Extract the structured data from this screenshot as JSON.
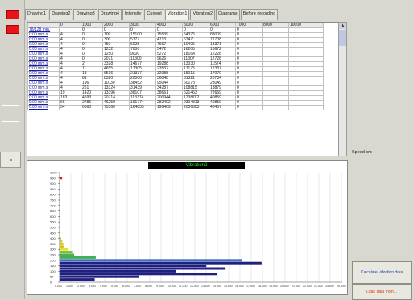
{
  "tabs": [
    "Drawing1",
    "Drawing2",
    "Drawing3",
    "Drawing4",
    "Intensity",
    "Current",
    "Vibration1",
    "Vibration2",
    "Diagrams",
    "Before recording"
  ],
  "table": {
    "headers": [
      "",
      "0",
      "1000",
      "2000",
      "3000",
      "4000",
      "5000",
      "6000",
      "7000",
      "8000",
      "10000"
    ],
    "rows": [
      [
        "78/128 min.",
        "",
        "0",
        "0",
        "0",
        "0",
        "0",
        "0",
        "0",
        "",
        ""
      ],
      [
        "0:00 mm.s",
        "4",
        "0",
        "100",
        "15100",
        "75539",
        "54375",
        "88009",
        "0",
        "",
        ""
      ],
      [
        "0:00 mm.s",
        "4",
        "0",
        "300",
        "5377",
        "4713",
        "6347",
        "72708",
        "0",
        "",
        ""
      ],
      [
        "0:00 mm.s",
        "4",
        "0",
        "750",
        "6025",
        "7667",
        "10406",
        "13371",
        "0",
        "",
        ""
      ],
      [
        "0:00 mm.s",
        "4",
        "0",
        "1252",
        "7006",
        "5472",
        "16205",
        "13672",
        "0",
        "",
        ""
      ],
      [
        "0:00 mm.s",
        "4",
        "0",
        "1250",
        "9000",
        "5272",
        "18164",
        "12228",
        "0",
        "",
        ""
      ],
      [
        "0:00 mm.s",
        "4",
        "0",
        "2071",
        "11300",
        "9626",
        "11307",
        "12728",
        "0",
        "",
        ""
      ],
      [
        "0:00 mm.s",
        "4",
        "2",
        "3328",
        "14677",
        "19288",
        "13030",
        "11574",
        "0",
        "",
        ""
      ],
      [
        "0:00 mm.s",
        "4",
        "11",
        "4655",
        "17305",
        "23532",
        "17175",
        "12337",
        "0",
        "",
        ""
      ],
      [
        "0:00 mm.s",
        "4",
        "13",
        "6516",
        "21337",
        "32088",
        "15015",
        "17070",
        "0",
        "",
        ""
      ],
      [
        "0:00 mm.s",
        "4",
        "81",
        "8320",
        "20000",
        "36048",
        "31321",
        "20734",
        "0",
        "",
        ""
      ],
      [
        "0:00 mm.s",
        "4",
        "196",
        "11030",
        "38452",
        "95044",
        "60178",
        "28049",
        "0",
        "",
        ""
      ],
      [
        "0:00 mm.s",
        "4",
        "261",
        "13324",
        "31439",
        "34287",
        "108815",
        "13879",
        "0",
        "",
        ""
      ],
      [
        "0:00 mm.s",
        "19",
        "1420",
        "13396",
        "36107",
        "38661",
        "621463",
        "72669",
        "0",
        "",
        ""
      ],
      [
        "0:00 mm.s",
        "183",
        "4593",
        "20714",
        "113374",
        "200944",
        "1238702",
        "40859",
        "0",
        "",
        ""
      ],
      [
        "0:00 mm.s",
        "66",
        "2786",
        "46250",
        "161774",
        "282402",
        "2304313",
        "40859",
        "0",
        "",
        ""
      ],
      [
        "0:00 mm.s",
        "54",
        "6560",
        "75360",
        "164853",
        "196469",
        "2006803",
        "40457",
        "0",
        "",
        ""
      ]
    ]
  },
  "speed_label": "Speed cm",
  "chart_data": {
    "type": "bar",
    "orientation": "horizontal",
    "title": "Vibration2",
    "y_ticks": [
      "1000",
      "950",
      "900",
      "850",
      "800",
      "750",
      "700",
      "650",
      "600",
      "550",
      "500",
      "450",
      "400",
      "350",
      "300",
      "250",
      "200",
      "150",
      "100",
      "50",
      "0"
    ],
    "x_ticks": [
      "0.000",
      "1.000",
      "2.000",
      "3.000",
      "4.000",
      "5.000",
      "6.000",
      "7.000",
      "8.000",
      "9.000",
      "10.000",
      "11.000",
      "12.000",
      "13.000",
      "14.000",
      "15.000",
      "16.000",
      "17.000",
      "18.000",
      "19.000",
      "20.000",
      "21.000",
      "22.000",
      "23.000",
      "24.000",
      "25.000"
    ],
    "bars": [
      {
        "y": 950,
        "value": 0.2,
        "color": "#d02020"
      },
      {
        "y": 400,
        "value": 0.1,
        "color": "#c8c828"
      },
      {
        "y": 375,
        "value": 0.2,
        "color": "#c8c828"
      },
      {
        "y": 350,
        "value": 0.3,
        "color": "#c8c828"
      },
      {
        "y": 325,
        "value": 0.4,
        "color": "#c8c828"
      },
      {
        "y": 300,
        "value": 0.8,
        "color": "#e8e020"
      },
      {
        "y": 275,
        "value": 1.2,
        "color": "#70c040"
      },
      {
        "y": 250,
        "value": 1.3,
        "color": "#50b050"
      },
      {
        "y": 225,
        "value": 3.3,
        "color": "#40b050"
      },
      {
        "y": 200,
        "value": 16.8,
        "color": "#4070c0"
      },
      {
        "y": 175,
        "value": 18.6,
        "color": "#202080"
      },
      {
        "y": 150,
        "value": 13.5,
        "color": "#202080"
      },
      {
        "y": 125,
        "value": 15.2,
        "color": "#202080"
      },
      {
        "y": 100,
        "value": 10.7,
        "color": "#202080"
      },
      {
        "y": 75,
        "value": 14.5,
        "color": "#202080"
      },
      {
        "y": 50,
        "value": 7.3,
        "color": "#202080"
      },
      {
        "y": 25,
        "value": 3.2,
        "color": "#202080"
      }
    ],
    "xlim": [
      0,
      26
    ],
    "ylim": [
      0,
      1000
    ]
  },
  "buttons": {
    "btn1": "Calculate vibration data",
    "btn2": "Load data from..."
  }
}
